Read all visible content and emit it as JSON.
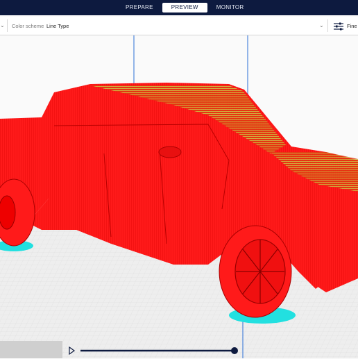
{
  "stages": {
    "tabs": [
      "PREPARE",
      "PREVIEW",
      "MONITOR"
    ],
    "active": "PREVIEW"
  },
  "toolbar": {
    "color_scheme_label": "Color scheme",
    "color_scheme_value": "Line Type",
    "print_settings_label": "Fine -"
  },
  "layer_slider": {
    "position": 1.0
  },
  "colors": {
    "header_bg": "#0d1a3f",
    "wall": "#ff1a1a",
    "infill_skin": "#c8d84a",
    "support_skirt": "#22e0e0",
    "axis_blue": "#2a6fd6"
  },
  "icons": [
    "chevron-down-icon",
    "settings-sliders-icon",
    "play-icon"
  ]
}
